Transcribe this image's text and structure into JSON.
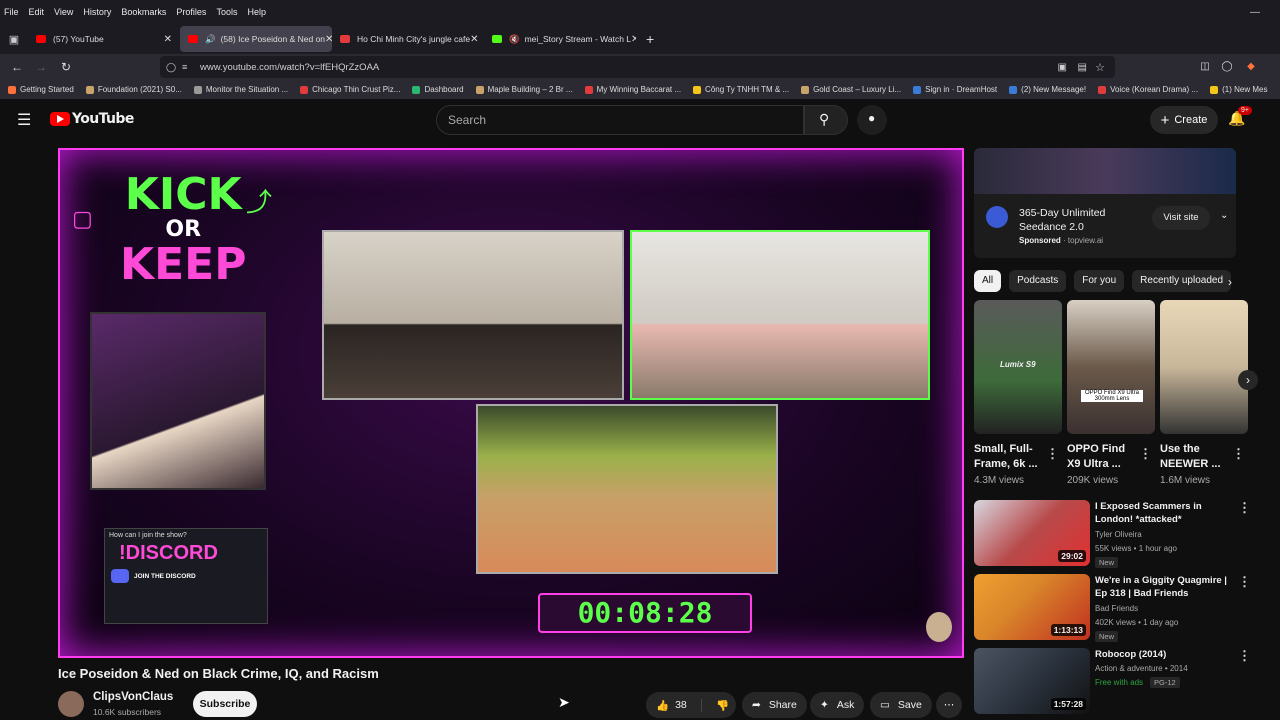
{
  "menu": [
    "File",
    "Edit",
    "View",
    "History",
    "Bookmarks",
    "Profiles",
    "Tools",
    "Help"
  ],
  "tabs": [
    {
      "label": "(57) YouTube",
      "favicon": "#ff0000"
    },
    {
      "label": "(58) Ice Poseidon & Ned on",
      "favicon": "#ff0000"
    },
    {
      "label": "Ho Chi Minh City's jungle cafe",
      "favicon": "#e33b3b"
    },
    {
      "label": "mei_Story Stream - Watch L",
      "favicon": "#53fc18"
    }
  ],
  "url": "www.youtube.com/watch?v=lfEHQrZzOAA",
  "bookmarks": [
    {
      "label": "Getting Started",
      "color": "#ff7139"
    },
    {
      "label": "Foundation (2021) S0...",
      "color": "#c9a46a"
    },
    {
      "label": "Monitor the Situation ...",
      "color": "#9a9a9a"
    },
    {
      "label": "Chicago Thin Crust Piz...",
      "color": "#e33b3b"
    },
    {
      "label": "Dashboard",
      "color": "#2bb673"
    },
    {
      "label": "Maple Building – 2 Br ...",
      "color": "#c9a46a"
    },
    {
      "label": "My Winning Baccarat ...",
      "color": "#e33b3b"
    },
    {
      "label": "Công Ty TNHH TM & ...",
      "color": "#f5c518"
    },
    {
      "label": "Gold Coast – Luxury Li...",
      "color": "#c9a46a"
    },
    {
      "label": "Sign in · DreamHost",
      "color": "#3a7bd5"
    },
    {
      "label": "(2) New Message!",
      "color": "#3a7bd5"
    },
    {
      "label": "Voice (Korean Drama) ...",
      "color": "#e33b3b"
    },
    {
      "label": "(1) New Mes",
      "color": "#f5c518"
    }
  ],
  "youtube": {
    "logo": "YouTube",
    "search_placeholder": "Search",
    "create_label": "Create",
    "notifications_badge": "9+"
  },
  "video": {
    "overlay_title_line1": "KICK",
    "overlay_title_line2": "OR",
    "overlay_title_line3": "KEEP",
    "discord_question": "How can I join the show?",
    "discord_label": "!DISCORD",
    "discord_cta": "JOIN THE DISCORD",
    "timer": "00:08:28",
    "title": "Ice Poseidon & Ned on Black Crime, IQ, and Racism",
    "channel": "ClipsVonClaus",
    "subscribers": "10.6K subscribers",
    "subscribe_label": "Subscribe",
    "likes": "38",
    "share_label": "Share",
    "ask_label": "Ask",
    "save_label": "Save"
  },
  "ad": {
    "title": "365-Day Unlimited Seedance 2.0",
    "sponsored": "Sponsored",
    "domain": "topview.ai",
    "cta": "Visit site"
  },
  "chips": [
    "All",
    "Podcasts",
    "For you",
    "Recently uploaded"
  ],
  "shorts": [
    {
      "title": "Small, Full-Frame, 6k ...",
      "views": "4.3M views",
      "color": "#3d6b3a",
      "overlay": "Lumix S9"
    },
    {
      "title": "OPPO Find X9 Ultra ...",
      "views": "209K views",
      "color": "#6b5a4a",
      "overlay": "OPPO Find X9 Ultra 300mm Lens"
    },
    {
      "title": "Use the NEEWER ...",
      "views": "1.6M views",
      "color": "#c9b79a",
      "overlay": ""
    }
  ],
  "videos": [
    {
      "title": "I Exposed Scammers in London! *attacked*",
      "channel": "Tyler Oliveira",
      "meta": "55K views • 1 hour ago",
      "badge": "New",
      "duration": "29:02",
      "color": "#b84a4a"
    },
    {
      "title": "We're in a Giggity Quagmire | Ep 318 | Bad Friends",
      "channel": "Bad Friends",
      "meta": "402K views • 1 day ago",
      "badge": "New",
      "duration": "1:13:13",
      "color": "#d9862a"
    },
    {
      "title": "Robocop (2014)",
      "channel": "Action & adventure • 2014",
      "meta": "Free with ads",
      "badge": "PG-12",
      "duration": "1:57:28",
      "color": "#2c3440"
    }
  ]
}
